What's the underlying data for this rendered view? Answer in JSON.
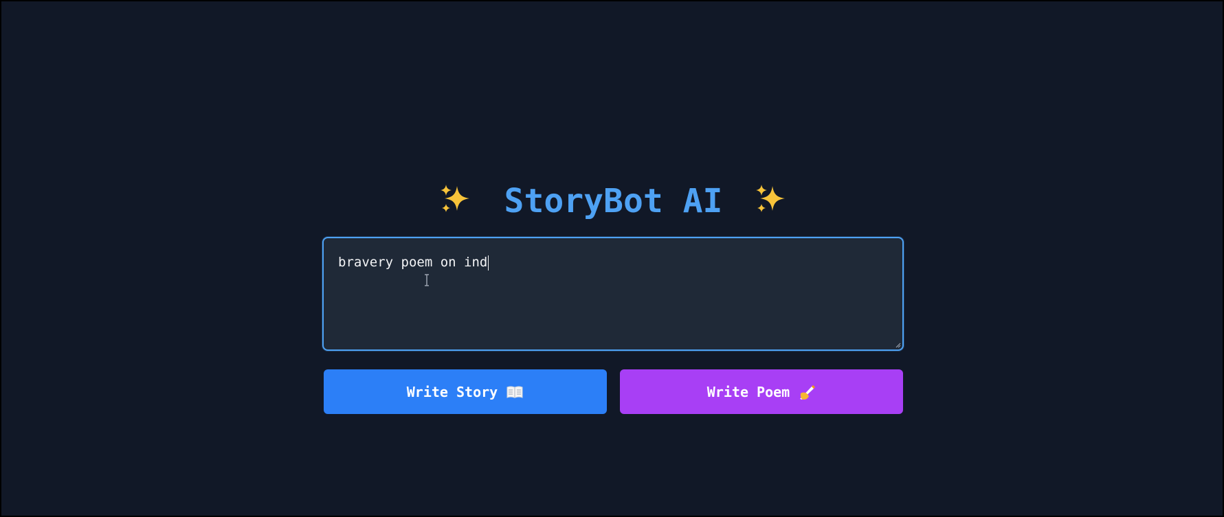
{
  "header": {
    "title": "StoryBot AI",
    "left_icon": "sparkles-icon",
    "right_icon": "sparkles-icon"
  },
  "prompt": {
    "value": "bravery poem on ind"
  },
  "actions": {
    "story_label": "Write Story",
    "story_icon": "open-book-icon",
    "poem_label": "Write Poem",
    "poem_icon": "writing-hand-icon"
  },
  "colors": {
    "background": "#111827",
    "title": "#4ea1f3",
    "input_background": "#1f2937",
    "input_border": "#4ea1f3",
    "story_button": "#2c7ff7",
    "poem_button": "#a83ff5"
  }
}
